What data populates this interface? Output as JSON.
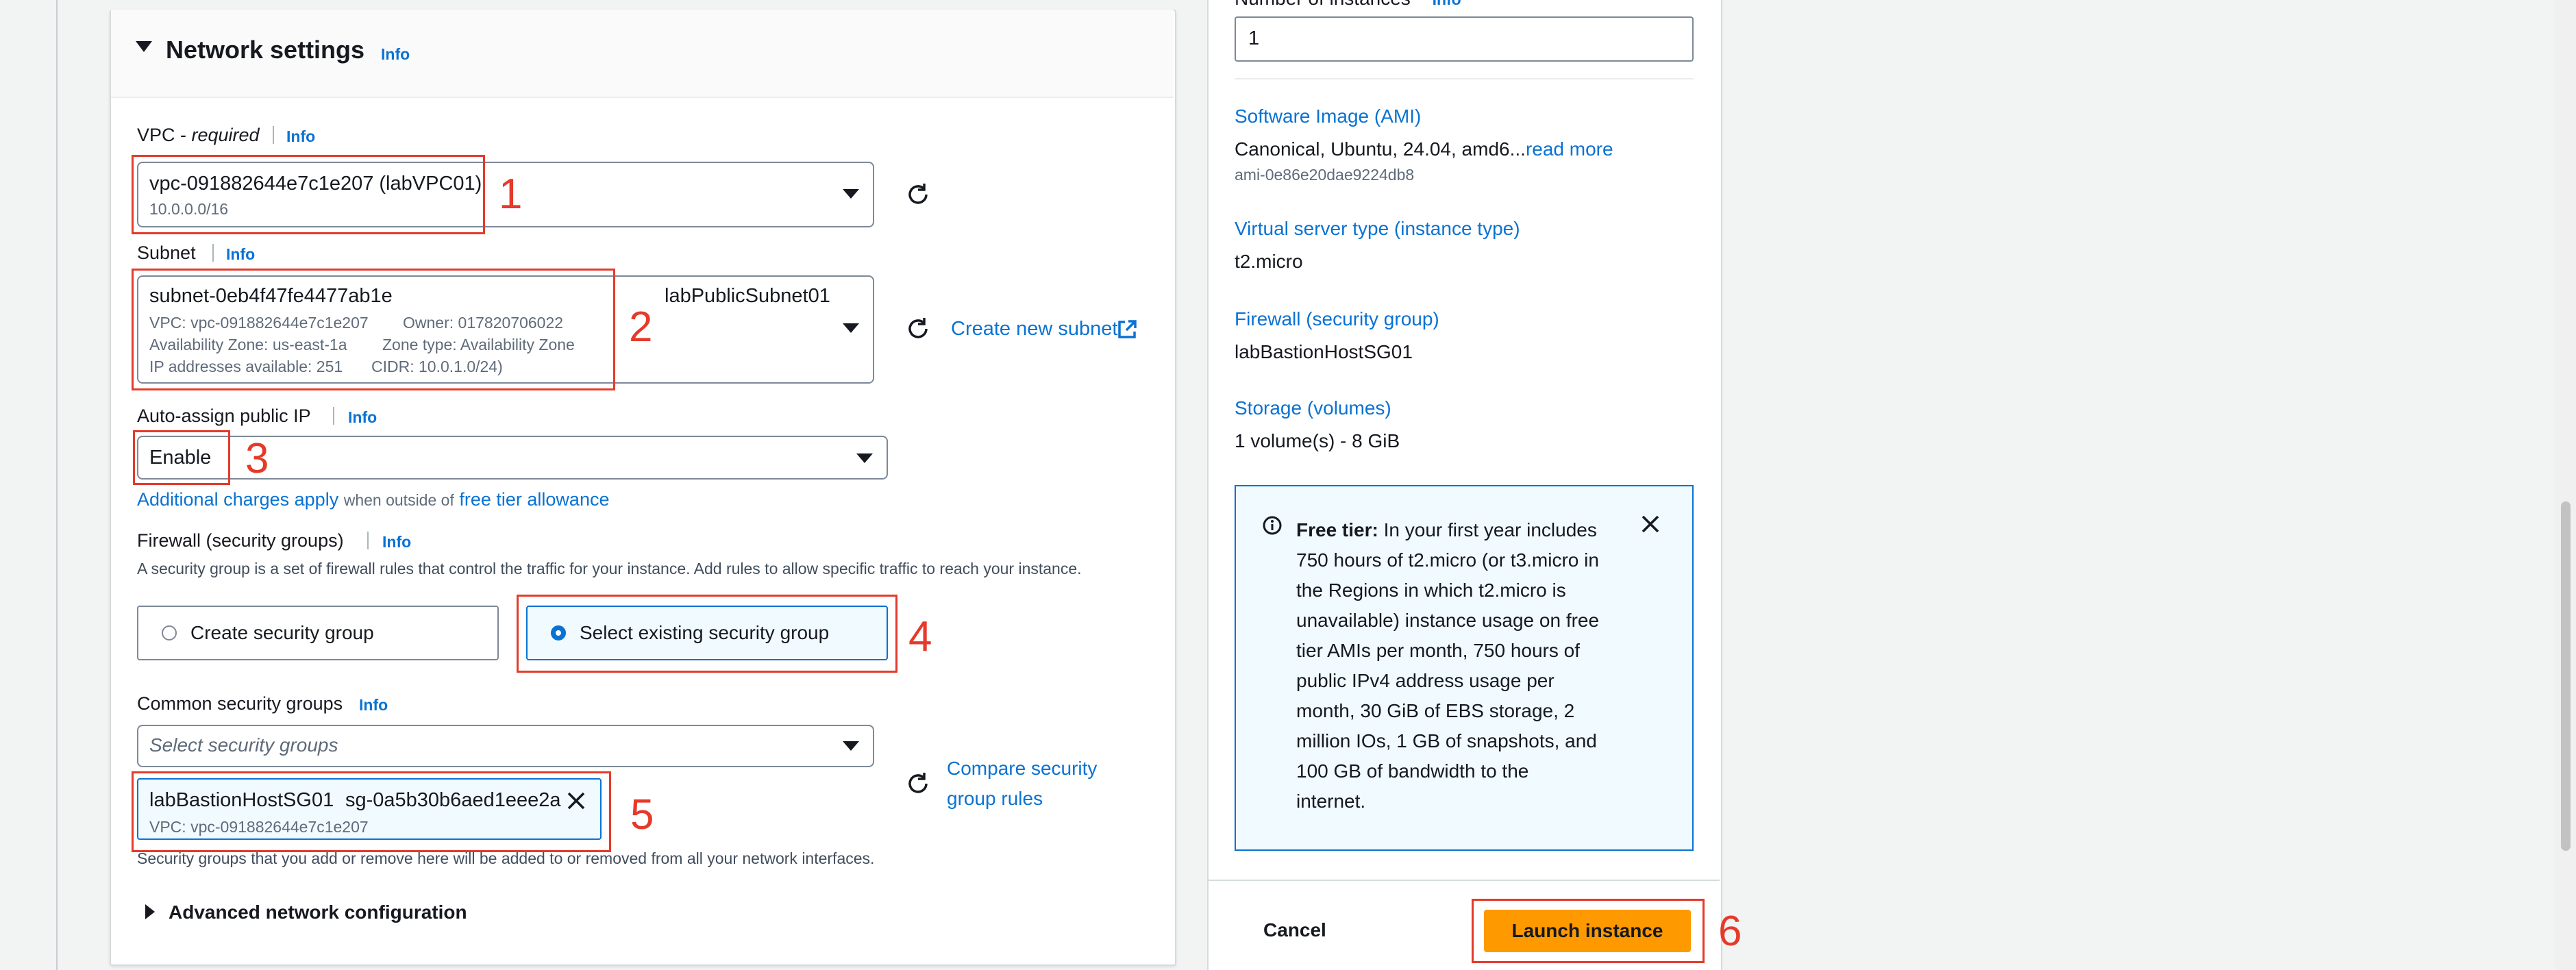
{
  "network": {
    "title": "Network settings",
    "info": "Info",
    "vpc": {
      "label_main": "VPC - ",
      "label_req": "required",
      "value": "vpc-091882644e7c1e207 (labVPC01)",
      "cidr": "10.0.0.0/16"
    },
    "subnet": {
      "label": "Subnet",
      "id": "subnet-0eb4f47fe4477ab1e",
      "name": "labPublicSubnet01",
      "vpc_line": "VPC: vpc-091882644e7c1e207",
      "owner_line": "Owner: 017820706022",
      "az_line": "Availability Zone: us-east-1a",
      "zone_type_line": "Zone type: Availability Zone",
      "ip_line": "IP addresses available: 251",
      "cidr_line": "CIDR: 10.0.1.0/24)",
      "create_link": "Create new subnet"
    },
    "auto_ip": {
      "label": "Auto-assign public IP",
      "value": "Enable",
      "charges_link": "Additional charges apply",
      "charges_mid": "when outside of",
      "free_link": "free tier allowance"
    },
    "firewall": {
      "label": "Firewall (security groups)",
      "description": "A security group is a set of firewall rules that control the traffic for your instance. Add rules to allow specific traffic to reach your instance.",
      "create_option": "Create security group",
      "select_option": "Select existing security group"
    },
    "common_sg": {
      "label": "Common security groups",
      "placeholder": "Select security groups",
      "token_name": "labBastionHostSG01",
      "token_id": "sg-0a5b30b6aed1eee2a",
      "token_vpc": "VPC: vpc-091882644e7c1e207",
      "compare_link_1": "Compare security",
      "compare_link_2": "group rules",
      "note": "Security groups that you add or remove here will be added to or removed from all your network interfaces."
    },
    "advanced": "Advanced network configuration"
  },
  "summary": {
    "instances_label": "Number of instances",
    "instances_info": "Info",
    "instances_value": "1",
    "ami_label": "Software Image (AMI)",
    "ami_value": "Canonical, Ubuntu, 24.04, amd6...",
    "ami_more": "read more",
    "ami_id": "ami-0e86e20dae9224db8",
    "type_label": "Virtual server type (instance type)",
    "type_value": "t2.micro",
    "fw_label": "Firewall (security group)",
    "fw_value": "labBastionHostSG01",
    "storage_label": "Storage (volumes)",
    "storage_value": "1 volume(s) - 8 GiB",
    "free_tier_bold": "Free tier:",
    "free_tier_lines": [
      "In your first year includes",
      "750 hours of t2.micro (or t3.micro in",
      "the Regions in which t2.micro is",
      "unavailable) instance usage on free",
      "tier AMIs per month, 750 hours of",
      "public IPv4 address usage per",
      "month, 30 GiB of EBS storage, 2",
      "million IOs, 1 GB of snapshots, and",
      "100 GB of bandwidth to the",
      "internet."
    ],
    "cancel": "Cancel",
    "launch": "Launch instance"
  },
  "annotations": [
    "1",
    "2",
    "3",
    "4",
    "5",
    "6"
  ],
  "colors": {
    "accent": "#0972d3",
    "launch": "#ff9900",
    "annotation": "#e53a2a"
  }
}
